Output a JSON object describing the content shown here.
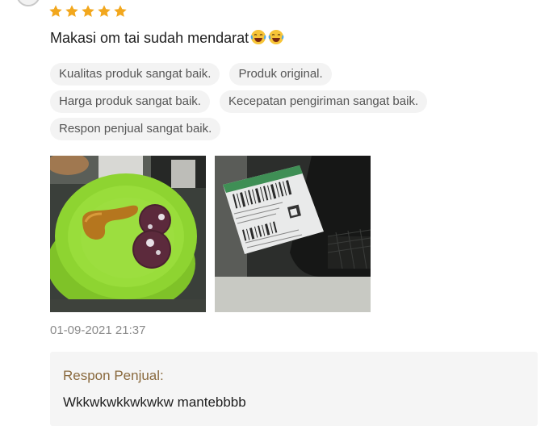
{
  "rating": {
    "stars": 5,
    "max": 5,
    "color": "#f2a71d"
  },
  "review": {
    "comment": "Makasi om tai sudah mendarat",
    "emoji_count": 2,
    "tags": [
      "Kualitas produk sangat baik.",
      "Produk original.",
      "Harga produk sangat baik.",
      "Kecepatan pengiriman sangat baik.",
      "Respon penjual sangat baik."
    ],
    "photos": [
      "food-plate-photo",
      "shipping-package-photo"
    ],
    "timestamp": "01-09-2021 21:37"
  },
  "seller_response": {
    "title": "Respon Penjual:",
    "text": "Wkkwkwkkwkwkw mantebbbb",
    "title_color": "#8a6a3e"
  }
}
